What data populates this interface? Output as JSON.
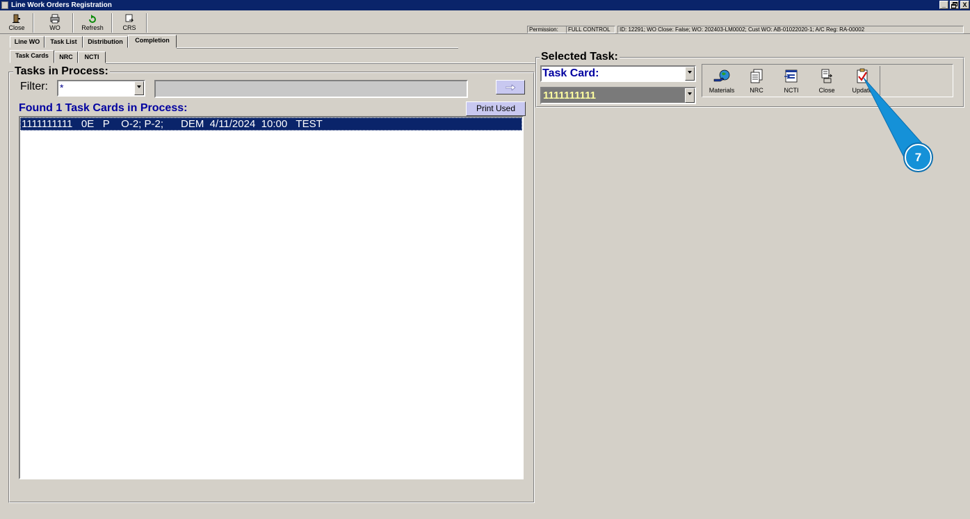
{
  "window": {
    "title": "Line Work Orders Registration",
    "controls": {
      "minimize": "_",
      "restore": "̅",
      "close": "X"
    }
  },
  "toolbar": {
    "close_label": "Close",
    "wo_label": "WO",
    "refresh_label": "Refresh",
    "crs_label": "CRS"
  },
  "info_bar": {
    "permission_label": "Permission:",
    "permission_value": "FULL CONTROL",
    "details": "ID: 12291; WO Close: False; WO: 202403-LM0002; Cust WO: AB-01022020-1; A/C Reg: RA-00002"
  },
  "main_tabs": [
    "Line WO",
    "Task List",
    "Distribution",
    "Completion"
  ],
  "sub_tabs": [
    "Task Cards",
    "NRC",
    "NCTI"
  ],
  "tasks_panel": {
    "title": "Tasks in Process:",
    "filter_label": "Filter:",
    "filter_value": "*",
    "found_text": "Found 1 Task Cards in Process:",
    "print_used_label": "Print Used",
    "rows": [
      "1111111111   0E   P    O-2; P-2;      DEM  4/11/2024  10:00   TEST"
    ]
  },
  "selected_panel": {
    "title": "Selected Task:",
    "type_value": "Task Card:",
    "id_value": "1111111111",
    "buttons": {
      "materials": "Materials",
      "nrc": "NRC",
      "ncti": "NCTI",
      "close": "Close",
      "update": "Update"
    }
  },
  "callout": {
    "number": "7",
    "color": "#1591d8"
  },
  "colors": {
    "window_bg": "#d4d0c8",
    "titlebar": "#0a246a",
    "selection": "#0a246a",
    "found_text": "#0000a0",
    "id_field_bg": "#7a7a7a",
    "id_field_text": "#ffffa0",
    "print_used_bg": "#c8c8f0"
  }
}
